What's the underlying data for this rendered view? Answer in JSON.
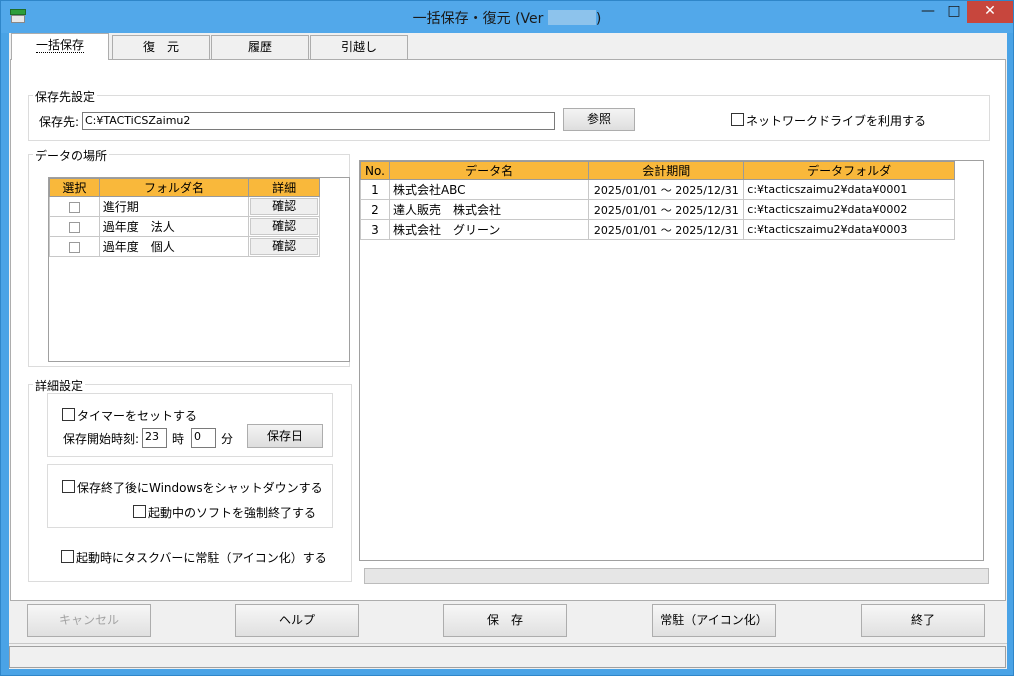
{
  "window": {
    "title_prefix": "一括保存・復元 (Ver ",
    "title_suffix": ")",
    "minimize": "—",
    "maximize": "□",
    "close": "✕"
  },
  "tabs": [
    {
      "label": "一括保存"
    },
    {
      "label": "復　元"
    },
    {
      "label": "履歴"
    },
    {
      "label": "引越し"
    }
  ],
  "save_dest": {
    "group_title": "保存先設定",
    "label": "保存先:",
    "path": "C:¥TACTiCSZaimu2",
    "browse_button": "参照",
    "network_label": "ネットワークドライブを利用する"
  },
  "data_location": {
    "group_title": "データの場所",
    "headers": [
      "選択",
      "フォルダ名",
      "詳細"
    ],
    "rows": [
      {
        "folder": "進行期",
        "detail": "確認"
      },
      {
        "folder": "過年度　法人",
        "detail": "確認"
      },
      {
        "folder": "過年度　個人",
        "detail": "確認"
      }
    ]
  },
  "detail_settings": {
    "group_title": "詳細設定",
    "timer_label": "タイマーをセットする",
    "start_time_label": "保存開始時刻:",
    "hour": "23",
    "hour_unit": "時",
    "minute": "0",
    "minute_unit": "分",
    "save_day_button": "保存日",
    "shutdown_label": "保存終了後にWindowsをシャットダウンする",
    "force_quit_label": "起動中のソフトを強制終了する",
    "resident_label": "起動時にタスクバーに常駐（アイコン化）する"
  },
  "data_list": {
    "headers": [
      "No.",
      "データ名",
      "会計期間",
      "データフォルダ"
    ],
    "rows": [
      {
        "no": "1",
        "name": "株式会社ABC",
        "period": "2025/01/01 ～ 2025/12/31",
        "folder": "c:¥tacticszaimu2¥data¥0001"
      },
      {
        "no": "2",
        "name": "達人販売　株式会社",
        "period": "2025/01/01 ～ 2025/12/31",
        "folder": "c:¥tacticszaimu2¥data¥0002"
      },
      {
        "no": "3",
        "name": "株式会社　グリーン",
        "period": "2025/01/01 ～ 2025/12/31",
        "folder": "c:¥tacticszaimu2¥data¥0003"
      }
    ]
  },
  "buttons": {
    "cancel": "キャンセル",
    "help": "ヘルプ",
    "save": "保　存",
    "resident": "常駐（アイコン化）",
    "exit": "終了"
  },
  "colors": {
    "titlebar": "#52a8ea",
    "header": "#f9b83b",
    "close": "#c7463d"
  }
}
